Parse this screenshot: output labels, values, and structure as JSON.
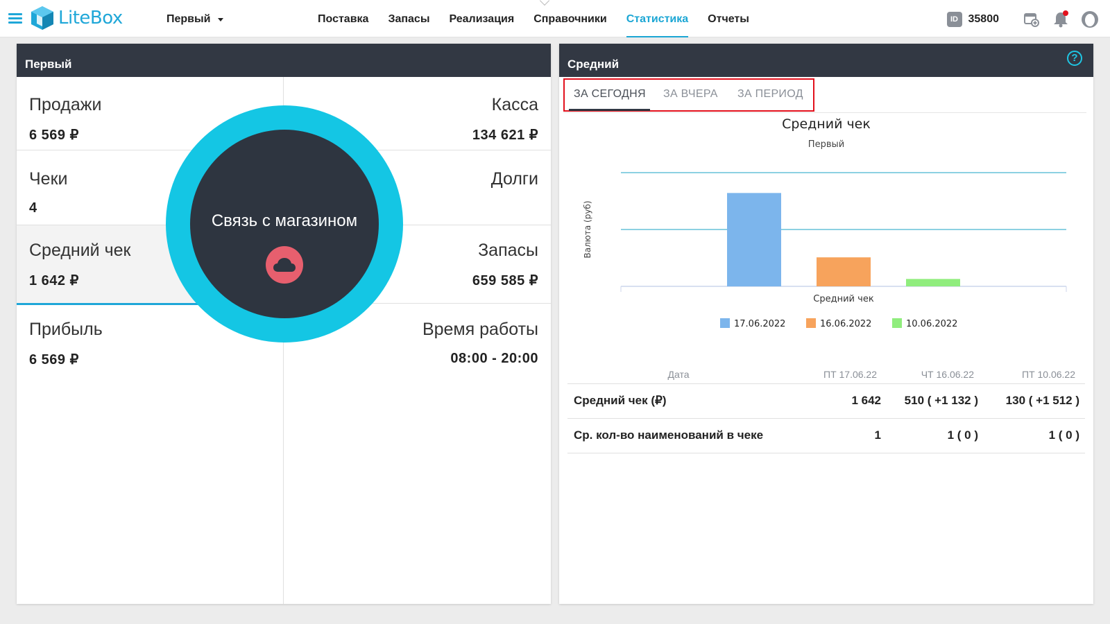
{
  "app": {
    "brand": "LiteBox"
  },
  "header": {
    "store_select": "Первый",
    "nav": [
      "Поставка",
      "Запасы",
      "Реализация",
      "Справочники",
      "Статистика",
      "Отчеты"
    ],
    "active_nav": "Статистика",
    "id_label": "ID",
    "user_id": "35800"
  },
  "left_panel": {
    "title": "Первый",
    "cells": [
      {
        "title": "Продажи",
        "value": "6 569 ₽"
      },
      {
        "title": "Касса",
        "value": "134 621 ₽"
      },
      {
        "title": "Чеки",
        "value": "4"
      },
      {
        "title": "Долги",
        "value": ""
      },
      {
        "title": "Средний чек",
        "value": "1 642 ₽"
      },
      {
        "title": "Запасы",
        "value": "659 585 ₽"
      },
      {
        "title": "Прибыль",
        "value": "6 569 ₽"
      },
      {
        "title": "Время работы",
        "value": "08:00 - 20:00"
      }
    ],
    "active_cell": "Средний чек",
    "overlay": {
      "text": "Связь с магазином",
      "icon": "cloud-icon",
      "ring_color": "#14c6e4",
      "button_color": "#e75f6e"
    }
  },
  "right_panel": {
    "title": "Средний",
    "help_icon": "?",
    "tabs": [
      "ЗА СЕГОДНЯ",
      "ЗА ВЧЕРА",
      "ЗА ПЕРИОД"
    ],
    "active_tab": "ЗА СЕГОДНЯ"
  },
  "chart_data": {
    "type": "bar",
    "title": "Средний чек",
    "subtitle": "Первый",
    "ylabel": "Валюта (руб)",
    "xlabel": "Средний чек",
    "categories": [
      "Средний чек"
    ],
    "ylim": [
      0,
      2000
    ],
    "grid": true,
    "legend_position": "bottom",
    "series": [
      {
        "name": "17.06.2022",
        "values": [
          1642
        ],
        "color": "#7cb5ec"
      },
      {
        "name": "16.06.2022",
        "values": [
          510
        ],
        "color": "#f7a35c"
      },
      {
        "name": "10.06.2022",
        "values": [
          130
        ],
        "color": "#90ed7d"
      }
    ]
  },
  "stats_table": {
    "headers": [
      "Дата",
      "ПТ 17.06.22",
      "ЧТ 16.06.22",
      "ПТ 10.06.22"
    ],
    "rows": [
      {
        "label": "Средний чек (₽)",
        "values": [
          "1 642",
          "510 ( +1 132 )",
          "130 ( +1 512 )"
        ]
      },
      {
        "label": "Ср. кол-во наименований в чеке",
        "values": [
          "1",
          "1 ( 0 )",
          "1 ( 0 )"
        ]
      }
    ]
  },
  "colors": {
    "accent": "#1fa7d8",
    "header_dark": "#323843",
    "highlight_box": "#e2101c"
  }
}
